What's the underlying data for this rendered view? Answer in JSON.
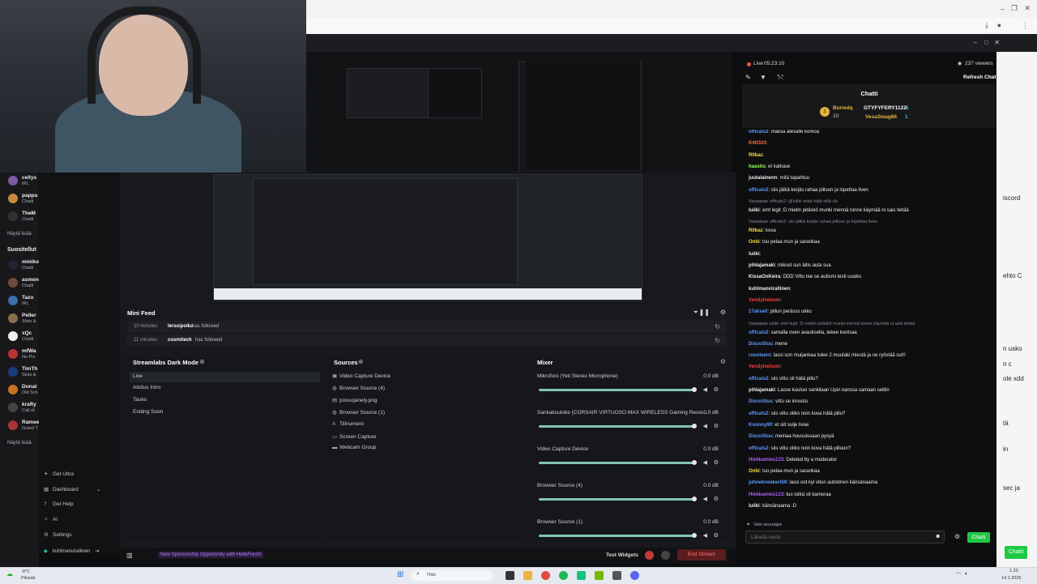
{
  "sidebar": {
    "followed": [
      {
        "name": "cellys",
        "category": "IRL",
        "color": "#7a5aa0"
      },
      {
        "name": "pappa",
        "category": "Chatti",
        "color": "#c78a3c"
      },
      {
        "name": "TheM",
        "category": "Chatti",
        "color": "#333"
      },
      {
        "more": "Näytä lisää"
      }
    ],
    "recommended_heading": "Suositellut",
    "recommended": [
      {
        "name": "mmiko",
        "category": "Chatti",
        "color": "#223"
      },
      {
        "name": "asmon",
        "category": "Chatti",
        "color": "#6a4b3b"
      },
      {
        "name": "Tazo",
        "category": "IRL",
        "color": "#3b6fa8"
      },
      {
        "name": "Peller",
        "category": "Slots &",
        "color": "#8a6f4a"
      },
      {
        "name": "xQc",
        "category": "Chatti",
        "color": "#eee"
      },
      {
        "name": "mfWa",
        "category": "No Pix",
        "color": "#b33"
      },
      {
        "name": "TimTh",
        "category": "Slots &",
        "color": "#1a3c7a"
      },
      {
        "name": "Donat",
        "category": "Old Sch",
        "color": "#c9711e"
      },
      {
        "name": "krafty",
        "category": "Call of",
        "color": "#444"
      },
      {
        "name": "Ramee",
        "category": "Grand T",
        "color": "#a33"
      }
    ],
    "more2": "Näytä lisää"
  },
  "nav": {
    "get_ultra": "Get Ultra",
    "dashboard": "Dashboard",
    "get_help": "Get Help",
    "ai": "AI",
    "settings": "Settings",
    "user": "kuhlmanvirallinen"
  },
  "minifeed": {
    "title": "Mini Feed",
    "rows": [
      {
        "time": "10 minutes",
        "name": "lerssipoika",
        "action": "has followed"
      },
      {
        "time": "11 minutes",
        "name": "cosmitech",
        "action": "has followed"
      }
    ]
  },
  "scenes": {
    "title": "Streamlabs Dark Mode",
    "items": [
      "Live",
      "Aloitus Intro",
      "Tauko",
      "Ending Soon"
    ]
  },
  "sources": {
    "title": "Sources",
    "items": [
      "Video Capture Device",
      "Browser Source (4)",
      "possujanely.png",
      "Browser Source (1)",
      "Tilinumero",
      "Screen Capture",
      "Webcam Group"
    ]
  },
  "mixer": {
    "title": "Mixer",
    "items": [
      {
        "name": "Mikrofoni (Yeti Stereo Microphone)",
        "db": "0.0 dB",
        "level": 1.0
      },
      {
        "name": "Sankakuuloke (CORSAIR VIRTUOSO MAX WIRELESS Gaming Recei...",
        "db": "0.0 dB",
        "level": 1.0
      },
      {
        "name": "Video Capture Device",
        "db": "0.0 dB",
        "level": 1.0
      },
      {
        "name": "Browser Source (4)",
        "db": "0.0 dB",
        "level": 1.0
      },
      {
        "name": "Browser Source (1)",
        "db": "0.0 dB",
        "level": 1.0
      }
    ]
  },
  "footer": {
    "promo": "New Sponsorship Opportunity with HelloFresh!",
    "test_widgets": "Test Widgets",
    "end_stream": "End Stream"
  },
  "chat": {
    "live": "Live",
    "time": "05:23:10",
    "viewers": "237 viewers",
    "refresh": "Refresh Chat",
    "title": "Chatti",
    "top": [
      {
        "name": "Buriedq",
        "count": "10"
      },
      {
        "name": "GTYFYFERY1122",
        "count": "6"
      },
      {
        "name": "VesaSwag86",
        "count": "1"
      }
    ],
    "messages": [
      {
        "user": "officals2",
        "color": "#5b9bff",
        "text": ": maksa alexalle korkoa"
      },
      {
        "user": "K4tt324",
        "color": "#ff6a3d",
        "text": ":"
      },
      {
        "user": "R0baz",
        "color": "#ffdf3d",
        "text": ":"
      },
      {
        "user": "haastis",
        "color": "#9cff57",
        "text": ": et katkase"
      },
      {
        "user": "juutalainenn",
        "color": "#efeff1",
        "text": ": mitä tapahtuu"
      },
      {
        "user": "officals2",
        "color": "#5b9bff",
        "text": ": siis jätkä kerjäs rahaa pilluun ja lopettaa liven"
      },
      {
        "reply": "Vastataan officals2: @luiiki mikä hätä siltä ub"
      },
      {
        "user": "luiiki",
        "color": "#efeff1",
        "text": ": emt legit :D mietin pitäskö munki mennä tonne käymää ni sais tietää"
      },
      {
        "reply": "Vastataan officals2: siis jätkä kerjäs rahaa pilluun ja lopettaa liven"
      },
      {
        "user": "R0baz",
        "color": "#ffdf3d",
        "text": ": kova"
      },
      {
        "user": "Onbi",
        "color": "#ffdf3d",
        "text": ": tuu pelaa mun ja sarankaa"
      },
      {
        "user": "luiiki",
        "color": "#efeff1",
        "text": ":"
      },
      {
        "user": "pihlajamaki",
        "color": "#efeff1",
        "text": ": mikset sun äitis auta sua"
      },
      {
        "user": "KissaOnKeira",
        "color": "#efeff1",
        "text": ": DDD Vittu tee se autismi testi uusiks"
      },
      {
        "user": "kuhlmanvirallinen",
        "color": "#efeff1",
        "text": ":"
      },
      {
        "user": "Vendylnelson",
        "color": "#ff3d3d",
        "text": ":"
      },
      {
        "user": "17aksell",
        "color": "#5b9bff",
        "text": ": pillun perässs ukko"
      },
      {
        "reply": "Vastataan luiiki: emt legit :D mietin pitäskö munki mennä tonne käymää ni sais tietää"
      },
      {
        "user": "officals2",
        "color": "#5b9bff",
        "text": ": samalla oven avauksella, tekee kontsaa"
      },
      {
        "user": "DiscoStuu",
        "color": "#5b9bff",
        "text": ": mene"
      },
      {
        "user": "roooteeni",
        "color": "#5b9bff",
        "text": ": lassi son muijankaa tulee 2 muutaki miestä ja ne ryöstää sut!!"
      },
      {
        "user": "Vendylnelson",
        "color": "#ff3d3d",
        "text": ":"
      },
      {
        "user": "officals2",
        "color": "#5b9bff",
        "text": ": siis vittu oli hätä pillu?"
      },
      {
        "user": "pihlajamaki",
        "color": "#efeff1",
        "text": ": Lasse kuulusi vankilaan Upin kanssa samaan selliin"
      },
      {
        "user": "DiscoStuu",
        "color": "#5b9bff",
        "text": ": vittu se innostu"
      },
      {
        "user": "officals2",
        "color": "#5b9bff",
        "text": ": siis vittu oliko noin kova hätä pillu?"
      },
      {
        "user": "Konnny90",
        "color": "#5b9bff",
        "text": ": et siit sulje livee"
      },
      {
        "user": "DiscoStuu",
        "color": "#5b9bff",
        "text": ": meinaa housuissaan pysyä"
      },
      {
        "user": "officals2",
        "color": "#5b9bff",
        "text": ": siis vittu oliko noin kova hätä pilluun?"
      },
      {
        "user": "Hiekkamies123",
        "color": "#b05bff",
        "text": ": Deleted by a moderator"
      },
      {
        "user": "Onbi",
        "color": "#ffdf3d",
        "text": ": tuu pelaa mun ja sarankaa"
      },
      {
        "user": "juhnekneekeri69",
        "color": "#5b9bff",
        "text": ": lassi oot kyl vitun autistinen känsänaama"
      },
      {
        "user": "Hiekkamies123",
        "color": "#b05bff",
        "text": ": tuo lutkä sit kameraa"
      },
      {
        "user": "luiiki",
        "color": "#efeff1",
        "text": ": känsänaama :D"
      }
    ],
    "followers_only": "Vain seuraajat",
    "input_placeholder": "Lähetä viesti",
    "send": "Chatti"
  },
  "right_strip": {
    "texts": [
      "iscord",
      "ehto C",
      "n usko",
      "n c",
      "ole xdd",
      "tä",
      "in",
      "sec ja"
    ],
    "chat_button": "Chatti"
  },
  "taskbar": {
    "weather": "-8°C",
    "weather_desc": "Pilvistä",
    "search": "Hae",
    "time": "1.23",
    "date": "14.1.2026"
  }
}
